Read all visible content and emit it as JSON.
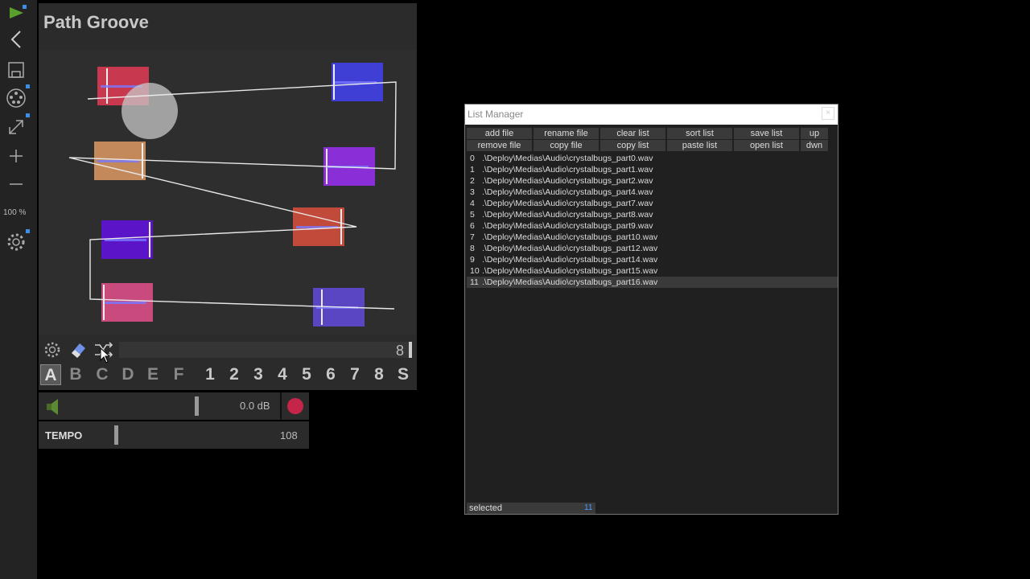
{
  "toolbar": {
    "zoom_label": "100 %",
    "accent_color": "#3b8eea",
    "icons": [
      "play-icon",
      "back-icon",
      "save-icon",
      "palette-icon",
      "expand-icon",
      "plus-icon",
      "minus-icon",
      "settings-icon"
    ]
  },
  "app": {
    "title": "Path Groove",
    "bar_value": "8",
    "letters": [
      "A",
      "B",
      "C",
      "D",
      "E",
      "F"
    ],
    "numbers": [
      "1",
      "2",
      "3",
      "4",
      "5",
      "6",
      "7",
      "8"
    ],
    "s_label": "S",
    "active_letter": "A",
    "blocks": [
      {
        "color": "#c8384f"
      },
      {
        "color": "#3f3fd6"
      },
      {
        "color": "#c4895a"
      },
      {
        "color": "#8a2fd8"
      },
      {
        "color": "#c24a3a"
      },
      {
        "color": "#5c14c8"
      },
      {
        "color": "#c94a7c"
      },
      {
        "color": "#5a45c2"
      }
    ]
  },
  "volume": {
    "value": "0.0 dB",
    "record_color": "#c6254a"
  },
  "tempo": {
    "label": "TEMPO",
    "value": "108"
  },
  "list_manager": {
    "title": "List Manager",
    "close_label": "×",
    "buttons_row1": [
      "add file",
      "rename file",
      "clear list",
      "sort list",
      "save list",
      "up"
    ],
    "buttons_row2": [
      "remove file",
      "copy file",
      "copy list",
      "paste list",
      "open list",
      "dwn"
    ],
    "rows": [
      {
        "index": "0",
        "path": ".\\Deploy\\Medias\\Audio\\crystalbugs_part0.wav"
      },
      {
        "index": "1",
        "path": ".\\Deploy\\Medias\\Audio\\crystalbugs_part1.wav"
      },
      {
        "index": "2",
        "path": ".\\Deploy\\Medias\\Audio\\crystalbugs_part2.wav"
      },
      {
        "index": "3",
        "path": ".\\Deploy\\Medias\\Audio\\crystalbugs_part4.wav"
      },
      {
        "index": "4",
        "path": ".\\Deploy\\Medias\\Audio\\crystalbugs_part7.wav"
      },
      {
        "index": "5",
        "path": ".\\Deploy\\Medias\\Audio\\crystalbugs_part8.wav"
      },
      {
        "index": "6",
        "path": ".\\Deploy\\Medias\\Audio\\crystalbugs_part9.wav"
      },
      {
        "index": "7",
        "path": ".\\Deploy\\Medias\\Audio\\crystalbugs_part10.wav"
      },
      {
        "index": "8",
        "path": ".\\Deploy\\Medias\\Audio\\crystalbugs_part12.wav"
      },
      {
        "index": "9",
        "path": ".\\Deploy\\Medias\\Audio\\crystalbugs_part14.wav"
      },
      {
        "index": "10",
        "path": ".\\Deploy\\Medias\\Audio\\crystalbugs_part15.wav"
      },
      {
        "index": "11",
        "path": ".\\Deploy\\Medias\\Audio\\crystalbugs_part16.wav"
      }
    ],
    "selected_index": "11",
    "status_label": "selected",
    "status_value": "11"
  }
}
